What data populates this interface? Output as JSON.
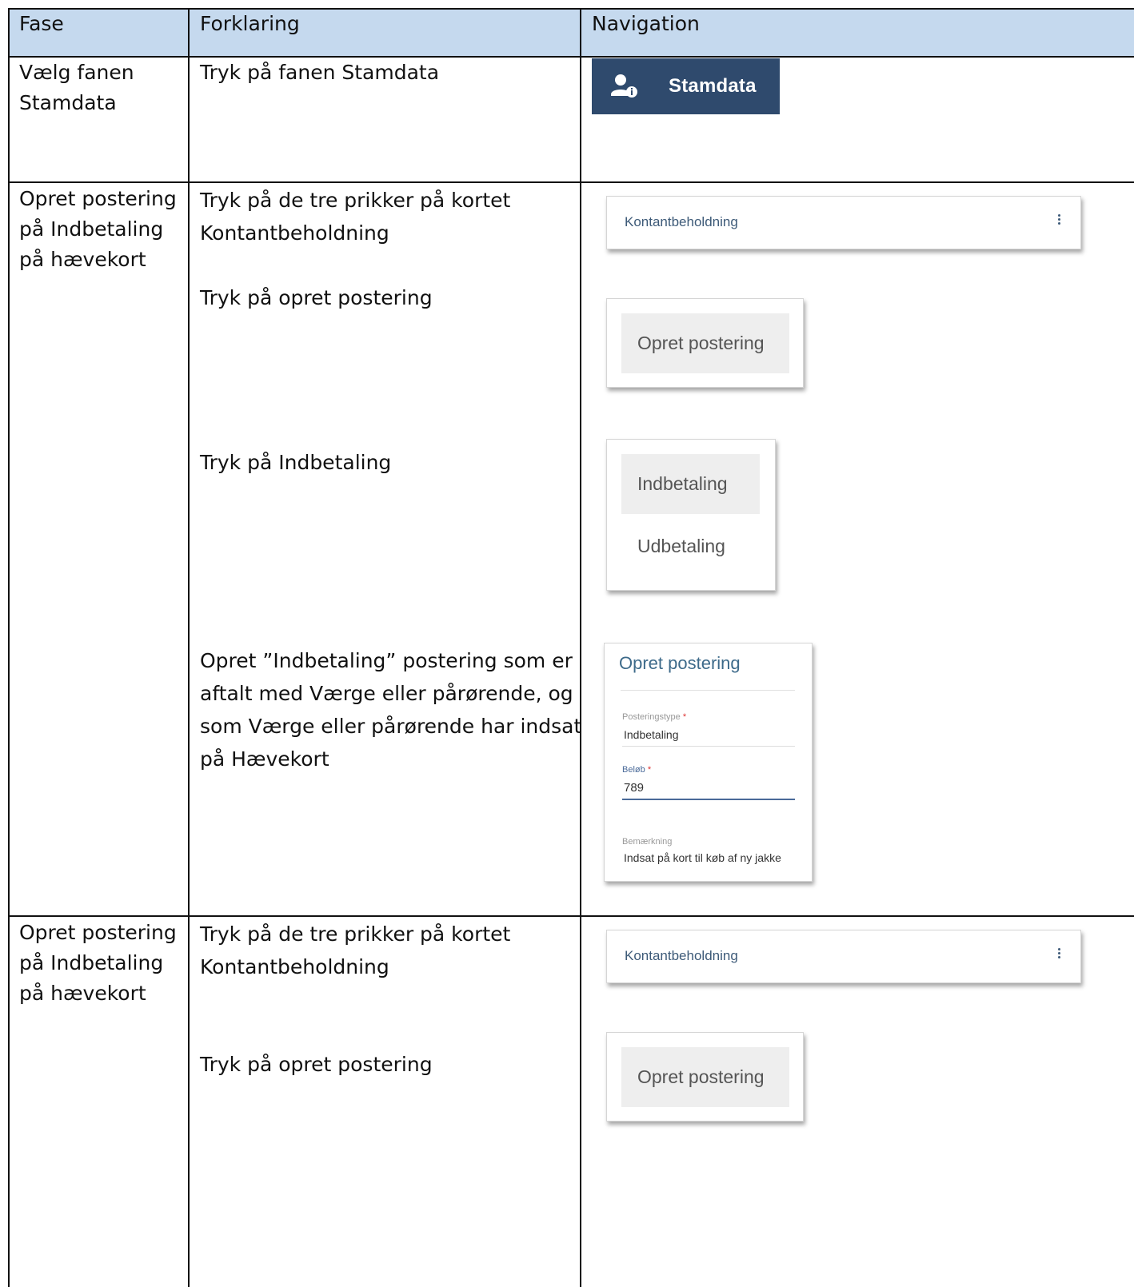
{
  "header": {
    "fase": "Fase",
    "forklaring": "Forklaring",
    "navigation": "Navigation"
  },
  "rows": [
    {
      "fase": "Vælg fanen\nStamdata",
      "steps": [
        "Tryk på fanen Stamdata"
      ],
      "nav": {
        "tab_label": "Stamdata",
        "tab_icon": "user-info-icon",
        "tab_color": "#2f4a6d"
      }
    },
    {
      "fase": "Opret postering\npå Indbetaling\npå hævekort",
      "steps": [
        "Tryk på de tre prikker på kortet\nKontantbeholdning",
        "Tryk på opret postering",
        "Tryk på Indbetaling",
        "Opret ”Indbetaling” postering som er\naftalt med Værge eller pårørende, og\nsom Værge eller pårørende har indsat\npå Hævekort"
      ],
      "nav": {
        "card_title": "Kontantbeholdning",
        "menu_button": "Opret postering",
        "menu_items": [
          "Indbetaling",
          "Udbetaling"
        ],
        "form": {
          "title": "Opret postering",
          "type_label": "Posteringstype",
          "type_value": "Indbetaling",
          "amount_label": "Beløb",
          "amount_value": "789",
          "note_label": "Bemærkning",
          "note_value": "Indsat på kort til køb af ny jakke",
          "required_mark": "*"
        }
      }
    },
    {
      "fase": "Opret postering\npå Indbetaling\npå hævekort",
      "steps": [
        "Tryk på de tre prikker på kortet\nKontantbeholdning",
        "Tryk på opret postering"
      ],
      "nav": {
        "card_title": "Kontantbeholdning",
        "menu_button": "Opret postering"
      }
    }
  ],
  "colors": {
    "header_bg": "#c5d9ee",
    "accent": "#3d5a78"
  }
}
